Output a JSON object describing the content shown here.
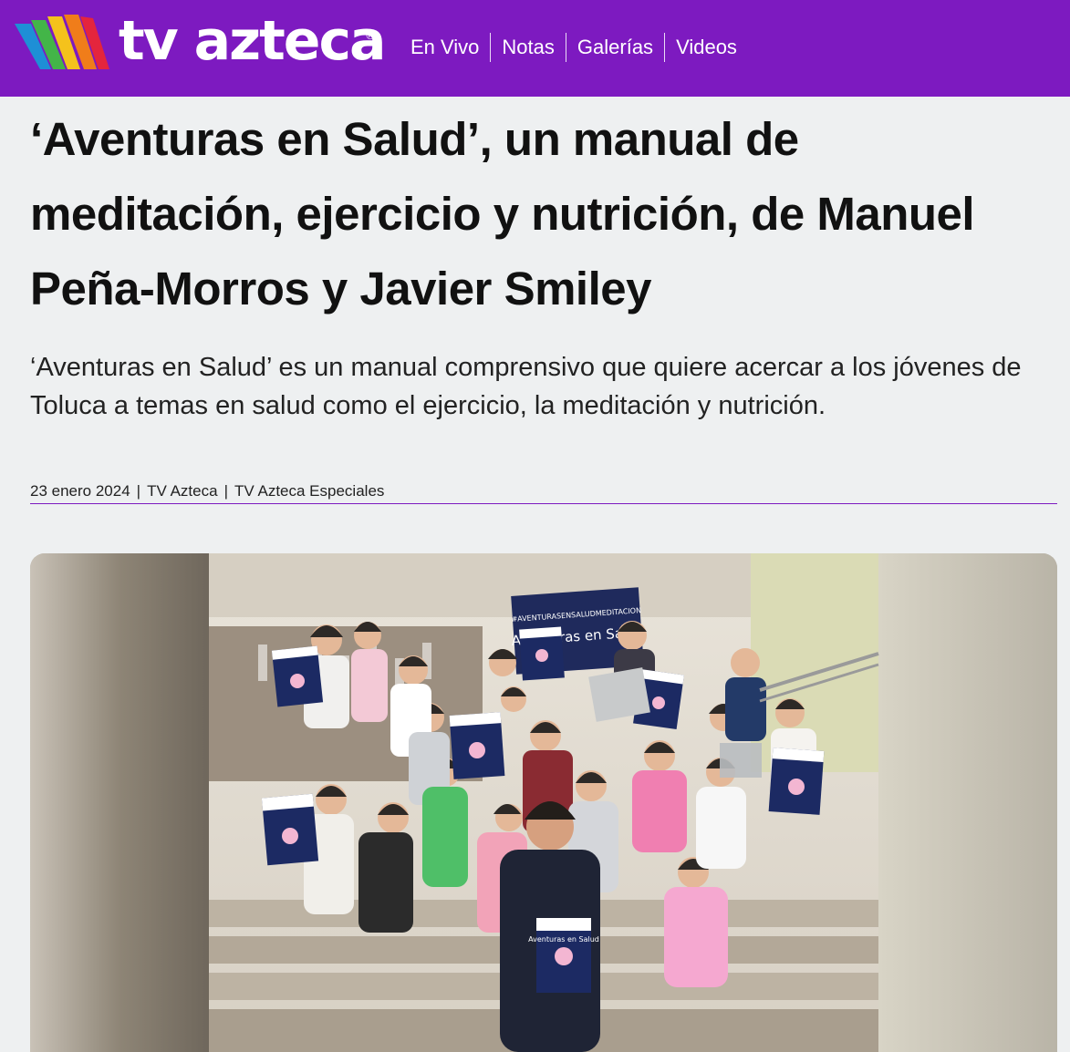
{
  "site": {
    "brand": "tv azteca",
    "registered": "®",
    "nav": [
      {
        "label": "En Vivo"
      },
      {
        "label": "Notas"
      },
      {
        "label": "Galerías"
      },
      {
        "label": "Videos"
      }
    ]
  },
  "article": {
    "title": "‘Aventuras en Salud’, un manual de meditación, ejercicio y nutrición, de Manuel Peña-Morros y Javier Smiley",
    "summary": "‘Aventuras en Salud’ es un manual comprensivo que quiere acercar a los jóvenes de Toluca a temas en salud como el ejercicio, la meditación y nutrición.",
    "date": "23 enero 2024",
    "author": "TV Azteca",
    "section": "TV Azteca Especiales",
    "separator": "|"
  },
  "photo": {
    "banner_small": "#AVENTURASENSALUDMEDITACION",
    "banner_title": "Aventuras en Salud",
    "book_title": "Aventuras en Salud"
  },
  "colors": {
    "brand_purple": "#7d1ac0",
    "background": "#eef0f1"
  }
}
